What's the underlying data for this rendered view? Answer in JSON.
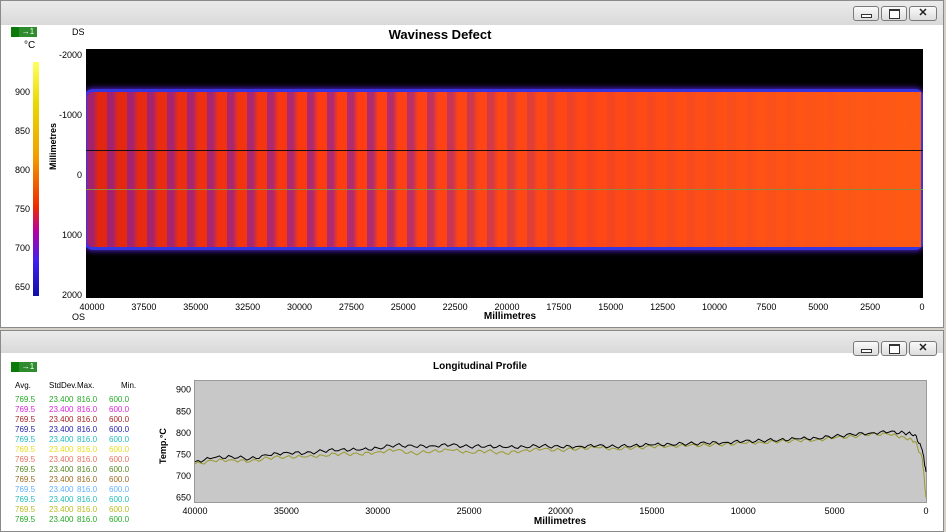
{
  "window_controls": {
    "minimize": "minimize-icon",
    "maximize": "maximize-icon",
    "close": "close-icon"
  },
  "top": {
    "title": "Waviness Defect",
    "badge": "→1",
    "unit": "°C",
    "ds_label": "DS",
    "os_label": "OS",
    "colorbar_ticks": [
      "900",
      "850",
      "800",
      "750",
      "700",
      "650"
    ],
    "y_ticks": [
      "-2000",
      "-1000",
      "0",
      "1000",
      "2000"
    ],
    "y_label": "Millimetres",
    "x_ticks": [
      "40000",
      "37500",
      "35000",
      "32500",
      "30000",
      "27500",
      "25000",
      "22500",
      "20000",
      "17500",
      "15000",
      "12500",
      "10000",
      "7500",
      "5000",
      "2500",
      "0"
    ],
    "x_label": "Millimetres",
    "line_colors": [
      "#000000",
      "#8c8c40"
    ]
  },
  "bottom": {
    "title": "Longitudinal Profile",
    "badge": "→1",
    "stats_headers": [
      "Avg.",
      "StdDev.",
      "Max.",
      "Min."
    ],
    "stats_rows": [
      {
        "color": "#22aa22",
        "avg": "769.5",
        "std": "23.400",
        "max": "816.0",
        "min": "600.0"
      },
      {
        "color": "#dd22dd",
        "avg": "769.5",
        "std": "23.400",
        "max": "816.0",
        "min": "600.0"
      },
      {
        "color": "#aa2222",
        "avg": "769.5",
        "std": "23.400",
        "max": "816.0",
        "min": "600.0"
      },
      {
        "color": "#2222aa",
        "avg": "769.5",
        "std": "23.400",
        "max": "816.0",
        "min": "600.0"
      },
      {
        "color": "#22bbbb",
        "avg": "769.5",
        "std": "23.400",
        "max": "816.0",
        "min": "600.0"
      },
      {
        "color": "#e8e020",
        "avg": "769.5",
        "std": "23.400",
        "max": "816.0",
        "min": "600.0"
      },
      {
        "color": "#e87060",
        "avg": "769.5",
        "std": "23.400",
        "max": "816.0",
        "min": "600.0"
      },
      {
        "color": "#558822",
        "avg": "769.5",
        "std": "23.400",
        "max": "816.0",
        "min": "600.0"
      },
      {
        "color": "#9a6a20",
        "avg": "769.5",
        "std": "23.400",
        "max": "816.0",
        "min": "600.0"
      },
      {
        "color": "#60b0ff",
        "avg": "769.5",
        "std": "23.400",
        "max": "816.0",
        "min": "600.0"
      },
      {
        "color": "#22bbbb",
        "avg": "769.5",
        "std": "23.400",
        "max": "816.0",
        "min": "600.0"
      },
      {
        "color": "#bbbb22",
        "avg": "769.5",
        "std": "23.400",
        "max": "816.0",
        "min": "600.0"
      },
      {
        "color": "#22aa22",
        "avg": "769.5",
        "std": "23.400",
        "max": "816.0",
        "min": "600.0"
      }
    ]
  },
  "chart_data": [
    {
      "type": "heatmap",
      "title": "Waviness Defect",
      "xlabel": "Millimetres",
      "ylabel": "Millimetres",
      "xlim": [
        40000,
        0
      ],
      "ylim": [
        -2000,
        2000
      ],
      "colorbar_label": "°C",
      "colorbar_range": [
        640,
        940
      ]
    },
    {
      "type": "line",
      "title": "Longitudinal Profile",
      "xlabel": "Millimetres",
      "ylabel": "Temp.°C",
      "xlim": [
        40000,
        0
      ],
      "ylim": [
        640,
        920
      ],
      "y_ticks": [
        "900",
        "850",
        "800",
        "750",
        "700",
        "650"
      ],
      "x_ticks": [
        "40000",
        "35000",
        "30000",
        "25000",
        "20000",
        "15000",
        "10000",
        "5000",
        "0"
      ],
      "series": [
        {
          "color": "#000000",
          "x": [
            40000,
            39000,
            38000,
            37000,
            36000,
            35000,
            34000,
            33000,
            32000,
            31000,
            30000,
            29000,
            28000,
            27000,
            26000,
            25000,
            24000,
            23000,
            22000,
            21000,
            20000,
            19000,
            18000,
            17000,
            16000,
            15000,
            14000,
            13000,
            12000,
            11000,
            10000,
            9000,
            8000,
            7000,
            6000,
            5000,
            4000,
            3000,
            2000,
            1200,
            600,
            200,
            0
          ],
          "values": [
            733,
            742,
            745,
            740,
            748,
            755,
            752,
            758,
            762,
            760,
            765,
            772,
            768,
            770,
            772,
            768,
            770,
            766,
            768,
            770,
            767,
            769,
            770,
            768,
            771,
            772,
            774,
            775,
            776,
            778,
            780,
            782,
            784,
            786,
            788,
            792,
            796,
            800,
            802,
            800,
            796,
            760,
            710
          ]
        },
        {
          "color": "#9a9a30",
          "x": [
            40000,
            39000,
            38000,
            37000,
            36000,
            35000,
            34000,
            33000,
            32000,
            31000,
            30000,
            29000,
            28000,
            27000,
            26000,
            25000,
            24000,
            23000,
            22000,
            21000,
            20000,
            19000,
            18000,
            17000,
            16000,
            15000,
            14000,
            13000,
            12000,
            11000,
            10000,
            9000,
            8000,
            7000,
            6000,
            5000,
            4000,
            3000,
            2000,
            1200,
            600,
            200,
            0
          ],
          "values": [
            728,
            735,
            738,
            733,
            742,
            745,
            744,
            748,
            752,
            750,
            756,
            760,
            752,
            758,
            760,
            755,
            758,
            752,
            760,
            762,
            760,
            764,
            766,
            763,
            765,
            768,
            770,
            770,
            772,
            774,
            776,
            778,
            780,
            782,
            784,
            788,
            792,
            798,
            796,
            790,
            780,
            740,
            650
          ]
        }
      ]
    }
  ]
}
